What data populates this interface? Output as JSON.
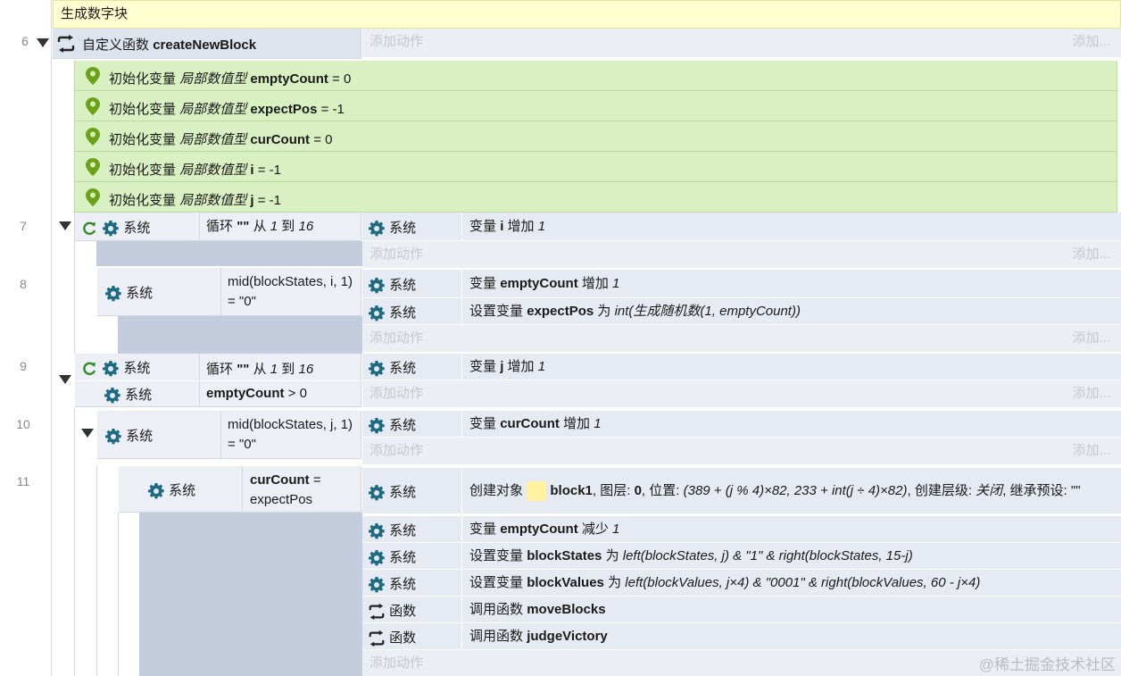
{
  "comment": "生成数字块",
  "function_header": {
    "line": "6",
    "label": "自定义函数",
    "name": "createNewBlock"
  },
  "add_action": "添加动作",
  "add_short": "添加...",
  "locals": [
    {
      "prefix": "初始化变量",
      "type": "局部数值型",
      "name": "emptyCount",
      "value": "= 0"
    },
    {
      "prefix": "初始化变量",
      "type": "局部数值型",
      "name": "expectPos",
      "value": "= -1"
    },
    {
      "prefix": "初始化变量",
      "type": "局部数值型",
      "name": "curCount",
      "value": "= 0"
    },
    {
      "prefix": "初始化变量",
      "type": "局部数值型",
      "name": "i",
      "value": "= -1"
    },
    {
      "prefix": "初始化变量",
      "type": "局部数值型",
      "name": "j",
      "value": "= -1"
    }
  ],
  "system": "系统",
  "function_label": "函数",
  "lines": {
    "l7": "7",
    "l8": "8",
    "l9": "9",
    "l10": "10",
    "l11": "11"
  },
  "loop_i": {
    "label": "循环",
    "name": "\"\"",
    "from": "从",
    "start": "1",
    "to": "到",
    "end": "16"
  },
  "loop_j": {
    "label": "循环",
    "name": "\"\"",
    "from": "从",
    "start": "1",
    "to": "到",
    "end": "16"
  },
  "cond_mid_i": "mid(blockStates, i, 1) = \"0\"",
  "cond_mid_j": "mid(blockStates, j, 1) = \"0\"",
  "cond_empty": {
    "name": "emptyCount",
    "rest": "> 0"
  },
  "cond_cur": {
    "name": "curCount",
    "rest": "= expectPos"
  },
  "act_i_inc": {
    "pre": "变量",
    "name": "i",
    "mid": "增加",
    "val": "1"
  },
  "act_empty_inc": {
    "pre": "变量",
    "name": "emptyCount",
    "mid": "增加",
    "val": "1"
  },
  "act_expect": {
    "pre": "设置变量",
    "name": "expectPos",
    "mid": "为",
    "val": "int(生成随机数(1, emptyCount))"
  },
  "act_j_inc": {
    "pre": "变量",
    "name": "j",
    "mid": "增加",
    "val": "1"
  },
  "act_cur_inc": {
    "pre": "变量",
    "name": "curCount",
    "mid": "增加",
    "val": "1"
  },
  "act_create": {
    "pre": "创建对象",
    "obj": "block1",
    "layer_label": ", 图层:",
    "layer": "0",
    "pos_label": ", 位置:",
    "pos": "(389 + (j % 4)×82, 233 + int(j ÷ 4)×82)",
    "lvl_label": ", 创建层级:",
    "lvl": "关闭",
    "inherit": ", 继承预设:",
    "inherit_val": "\"\""
  },
  "act_empty_dec": {
    "pre": "变量",
    "name": "emptyCount",
    "mid": "减少",
    "val": "1"
  },
  "act_states": {
    "pre": "设置变量",
    "name": "blockStates",
    "mid": "为",
    "val": "left(blockStates, j) & \"1\" & right(blockStates, 15-j)"
  },
  "act_values": {
    "pre": "设置变量",
    "name": "blockValues",
    "mid": "为",
    "val": "left(blockValues, j×4) & \"0001\" & right(blockValues, 60 - j×4)"
  },
  "act_move": {
    "pre": "调用函数",
    "name": "moveBlocks"
  },
  "act_judge": {
    "pre": "调用函数",
    "name": "judgeVictory"
  },
  "watermark": "@稀土掘金技术社区",
  "colors": {
    "accent_teal": "#1d6b82",
    "pin_green": "#6aa318",
    "comment_bg": "#ffffcf"
  }
}
